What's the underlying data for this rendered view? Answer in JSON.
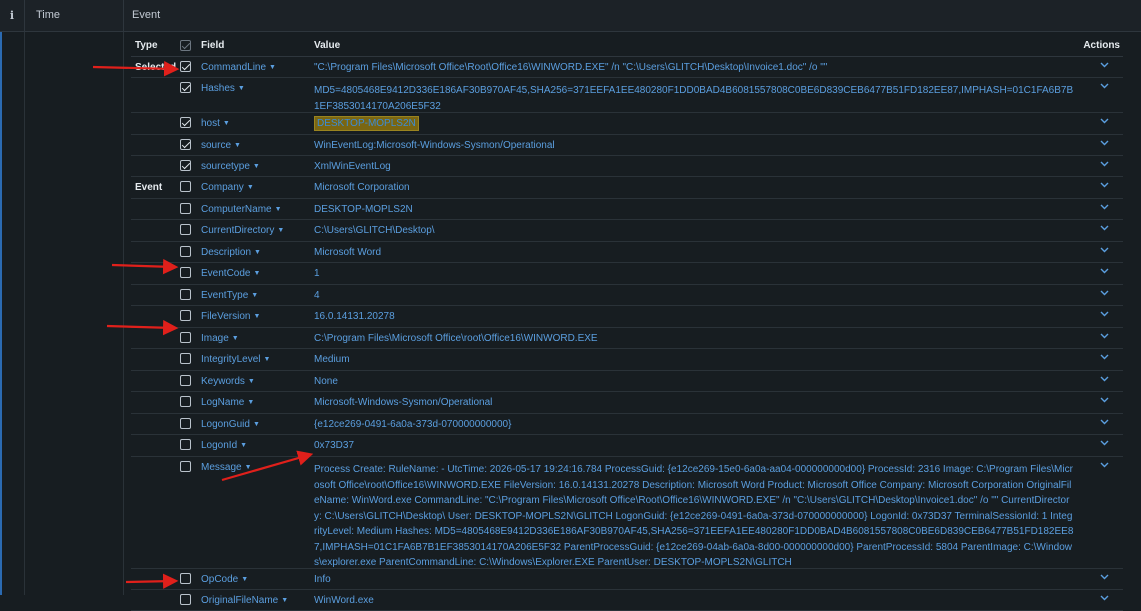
{
  "header": {
    "info_icon": "i",
    "time_label": "Time",
    "event_label": "Event"
  },
  "table": {
    "col_type": "Type",
    "col_field": "Field",
    "col_value": "Value",
    "col_actions": "Actions",
    "type_selected": "Selected",
    "type_event": "Event",
    "rows": [
      {
        "field": "CommandLine",
        "value": "\"C:\\Program Files\\Microsoft Office\\Root\\Office16\\WINWORD.EXE\" /n \"C:\\Users\\GLITCH\\Desktop\\Invoice1.doc\" /o \"\"",
        "checked": true
      },
      {
        "field": "Hashes",
        "value": "MD5=4805468E9412D336E186AF30B970AF45,SHA256=371EEFA1EE480280F1DD0BAD4B6081557808C0BE6D839CEB6477B51FD182EE87,IMPHASH=01C1FA6B7B1EF3853014170A206E5F32",
        "checked": true
      },
      {
        "field": "host",
        "value": "DESKTOP-MOPLS2N",
        "checked": true
      },
      {
        "field": "source",
        "value": "WinEventLog:Microsoft-Windows-Sysmon/Operational",
        "checked": true
      },
      {
        "field": "sourcetype",
        "value": "XmlWinEventLog",
        "checked": true
      },
      {
        "field": "Company",
        "value": "Microsoft Corporation",
        "checked": false
      },
      {
        "field": "ComputerName",
        "value": "DESKTOP-MOPLS2N",
        "checked": false
      },
      {
        "field": "CurrentDirectory",
        "value": "C:\\Users\\GLITCH\\Desktop\\",
        "checked": false
      },
      {
        "field": "Description",
        "value": "Microsoft Word",
        "checked": false
      },
      {
        "field": "EventCode",
        "value": "1",
        "checked": false
      },
      {
        "field": "EventType",
        "value": "4",
        "checked": false
      },
      {
        "field": "FileVersion",
        "value": "16.0.14131.20278",
        "checked": false
      },
      {
        "field": "Image",
        "value": "C:\\Program Files\\Microsoft Office\\root\\Office16\\WINWORD.EXE",
        "checked": false
      },
      {
        "field": "IntegrityLevel",
        "value": "Medium",
        "checked": false
      },
      {
        "field": "Keywords",
        "value": "None",
        "checked": false
      },
      {
        "field": "LogName",
        "value": "Microsoft-Windows-Sysmon/Operational",
        "checked": false
      },
      {
        "field": "LogonGuid",
        "value": "{e12ce269-0491-6a0a-373d-070000000000}",
        "checked": false
      },
      {
        "field": "LogonId",
        "value": "0x73D37",
        "checked": false
      },
      {
        "field": "Message",
        "value": "Process Create: RuleName: - UtcTime: 2026-05-17 19:24:16.784 ProcessGuid: {e12ce269-15e0-6a0a-aa04-000000000d00} ProcessId: 2316 Image: C:\\Program Files\\Microsoft Office\\root\\Office16\\WINWORD.EXE FileVersion: 16.0.14131.20278 Description: Microsoft Word Product: Microsoft Office Company: Microsoft Corporation OriginalFileName: WinWord.exe CommandLine: \"C:\\Program Files\\Microsoft Office\\Root\\Office16\\WINWORD.EXE\" /n \"C:\\Users\\GLITCH\\Desktop\\Invoice1.doc\" /o \"\" CurrentDirectory: C:\\Users\\GLITCH\\Desktop\\ User: DESKTOP-MOPLS2N\\GLITCH LogonGuid: {e12ce269-0491-6a0a-373d-070000000000} LogonId: 0x73D37 TerminalSessionId: 1 IntegrityLevel: Medium Hashes: MD5=4805468E9412D336E186AF30B970AF45,SHA256=371EEFA1EE480280F1DD0BAD4B6081557808C0BE6D839CEB6477B51FD182EE87,IMPHASH=01C1FA6B7B1EF3853014170A206E5F32 ParentProcessGuid: {e12ce269-04ab-6a0a-8d00-000000000d00} ParentProcessId: 5804 ParentImage: C:\\Windows\\explorer.exe ParentCommandLine: C:\\Windows\\Explorer.EXE ParentUser: DESKTOP-MOPLS2N\\GLITCH",
        "checked": false
      },
      {
        "field": "OpCode",
        "value": "Info",
        "checked": false
      },
      {
        "field": "OriginalFileName",
        "value": "WinWord.exe",
        "checked": false
      }
    ]
  },
  "colors": {
    "field_blue": "#5b9fe0",
    "highlight": "#7a6612",
    "arrow_red": "#e0201b"
  },
  "icons": {
    "action": "chevron-down-icon",
    "field_caret": "caret-down-icon",
    "checkbox": "checkbox-icon"
  }
}
